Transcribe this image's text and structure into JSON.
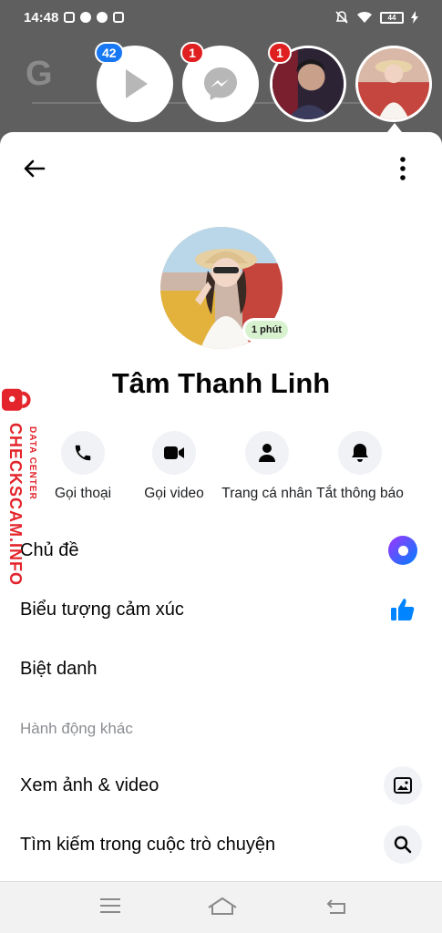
{
  "status_bar": {
    "time": "14:48",
    "battery": "44"
  },
  "chat_heads": [
    {
      "name": "play-store-head",
      "badge": "42"
    },
    {
      "name": "messenger-head",
      "badge": "1"
    },
    {
      "name": "contact-head",
      "badge": "1"
    },
    {
      "name": "active-chat-head",
      "badge": ""
    }
  ],
  "profile": {
    "name": "Tâm Thanh Linh",
    "active_status": "1 phút"
  },
  "actions": [
    {
      "label": "Gọi thoại",
      "icon": "phone-icon"
    },
    {
      "label": "Gọi video",
      "icon": "video-camera-icon"
    },
    {
      "label": "Trang cá nhân",
      "icon": "person-icon"
    },
    {
      "label": "Tắt thông báo",
      "icon": "bell-icon"
    }
  ],
  "settings": {
    "theme": "Chủ đề",
    "emoji": "Biểu tượng cảm xúc",
    "nicknames": "Biệt danh",
    "section_title": "Hành động khác",
    "media": "Xem ảnh & video",
    "search": "Tìm kiếm trong cuộc trò chuyện"
  },
  "watermark": {
    "brand": "CHECKSCAM.INFO",
    "sub": "DATA CENTER"
  },
  "colors": {
    "accent": "#0084ff",
    "badge_red": "#e02020",
    "badge_blue": "#1877f2",
    "watermark": "#e3242b"
  }
}
